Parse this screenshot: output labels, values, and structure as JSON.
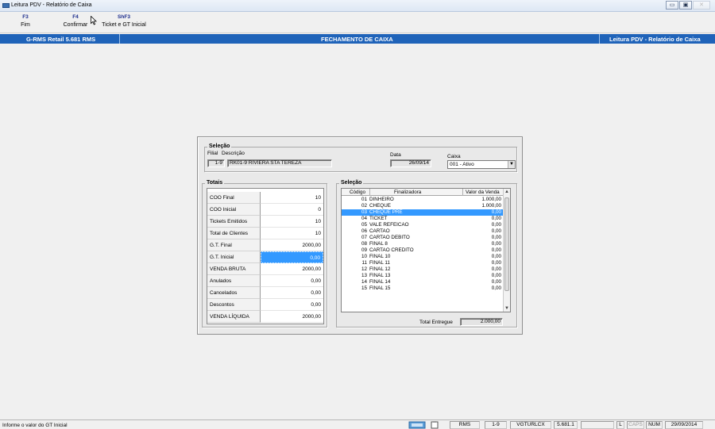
{
  "window": {
    "title": "Leitura PDV - Relatório de Caixa",
    "buttons": [
      "▭",
      "▣",
      "✕"
    ]
  },
  "toolbar": {
    "buttons": [
      {
        "key": "F3",
        "label": "Fim"
      },
      {
        "key": "F4",
        "label": "Confirmar"
      },
      {
        "key": "ShF3",
        "label": "Ticket e GT Inicial"
      }
    ]
  },
  "header": {
    "left": "G-RMS Retail 5.681 RMS",
    "center": "FECHAMENTO DE CAIXA",
    "right": "Leitura PDV - Relatório de Caixa"
  },
  "selecao_top": {
    "title": "Seleção",
    "filial_label": "Filial",
    "filial_value": "1-9",
    "descricao_label": "Descrição",
    "descricao_value": "RK01-9 RIVIERA STA TEREZA",
    "data_label": "Data",
    "data_value": "26/09/14",
    "caixa_label": "Caixa",
    "caixa_value": "001 - Ativo"
  },
  "totais": {
    "title": "Totais",
    "rows": [
      {
        "label": "COO Final",
        "value": "10"
      },
      {
        "label": "COO Inicial",
        "value": "0"
      },
      {
        "label": "Tickets Emitidos",
        "value": "10"
      },
      {
        "label": "Total de Clientes",
        "value": "10"
      },
      {
        "label": "G.T. Final",
        "value": "2000,00"
      },
      {
        "label": "G.T. Inicial",
        "value": "0,00"
      },
      {
        "label": "VENDA BRUTA",
        "value": "2000,00"
      },
      {
        "label": "Anulados",
        "value": "0,00"
      },
      {
        "label": "Cancelados",
        "value": "0,00"
      },
      {
        "label": "Descontos",
        "value": "0,00"
      },
      {
        "label": "VENDA LÍQUIDA",
        "value": "2000,00"
      }
    ]
  },
  "selecao_list": {
    "title": "Seleção",
    "columns": [
      "Código",
      "Finalizadora",
      "Valor da Venda"
    ],
    "rows": [
      {
        "cod": "01",
        "fin": "DINHEIRO",
        "val": "1.000,00"
      },
      {
        "cod": "02",
        "fin": "CHEQUE",
        "val": "1.000,00"
      },
      {
        "cod": "03",
        "fin": "CHEQUE PRE",
        "val": "0,00"
      },
      {
        "cod": "04",
        "fin": "TICKET",
        "val": "0,00"
      },
      {
        "cod": "05",
        "fin": "VALE REFEICAO",
        "val": "0,00"
      },
      {
        "cod": "06",
        "fin": "CARTAO",
        "val": "0,00"
      },
      {
        "cod": "07",
        "fin": "CARTAO DEBITO",
        "val": "0,00"
      },
      {
        "cod": "08",
        "fin": "FINAL 8",
        "val": "0,00"
      },
      {
        "cod": "09",
        "fin": "CARTAO CREDITO",
        "val": "0,00"
      },
      {
        "cod": "10",
        "fin": "FINAL 10",
        "val": "0,00"
      },
      {
        "cod": "11",
        "fin": "FINAL 11",
        "val": "0,00"
      },
      {
        "cod": "12",
        "fin": "FINAL 12",
        "val": "0,00"
      },
      {
        "cod": "13",
        "fin": "FINAL 13",
        "val": "0,00"
      },
      {
        "cod": "14",
        "fin": "FINAL 14",
        "val": "0,00"
      },
      {
        "cod": "15",
        "fin": "FINAL 15",
        "val": "0,00"
      }
    ],
    "total_label": "Total Entregue",
    "total_value": "2.000,00"
  },
  "statusbar": {
    "message": "Informe o valor do GT Inicial",
    "cells": [
      "RMS",
      "1-9",
      "VGTURLCX",
      "5.681.1",
      "",
      "L",
      "CAPS",
      "NUM",
      "29/09/2014"
    ]
  },
  "colors": {
    "header_blue": "#1f63b9",
    "selection_blue": "#3399ff"
  }
}
